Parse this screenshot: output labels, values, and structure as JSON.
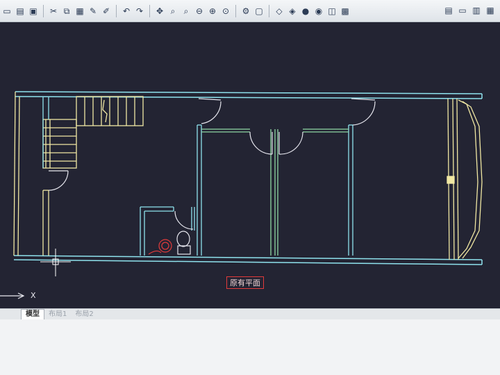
{
  "toolbar": {
    "buttons": [
      {
        "name": "new-icon",
        "glyph": "▭"
      },
      {
        "name": "open-icon",
        "glyph": "▤"
      },
      {
        "name": "save-icon",
        "glyph": "▣"
      },
      {
        "name": "cut-icon",
        "glyph": "✂"
      },
      {
        "name": "copy-icon",
        "glyph": "⧉"
      },
      {
        "name": "paste-icon",
        "glyph": "▦"
      },
      {
        "name": "match-properties-icon",
        "glyph": "✎"
      },
      {
        "name": "block-editor-icon",
        "glyph": "✐"
      },
      {
        "name": "undo-icon",
        "glyph": "↶"
      },
      {
        "name": "redo-icon",
        "glyph": "↷"
      },
      {
        "name": "pan-icon",
        "glyph": "✥"
      },
      {
        "name": "zoom-realtime-icon",
        "glyph": "⌕"
      },
      {
        "name": "zoom-window-icon",
        "glyph": "⌕"
      },
      {
        "name": "zoom-previous-icon",
        "glyph": "⊖"
      },
      {
        "name": "zoom-in-icon",
        "glyph": "⊕"
      },
      {
        "name": "zoom-out-icon",
        "glyph": "⊙"
      },
      {
        "name": "properties-icon",
        "glyph": "⚙"
      },
      {
        "name": "design-center-icon",
        "glyph": "▢"
      },
      {
        "name": "tool-palette-icon",
        "glyph": "◇"
      },
      {
        "name": "sheet-set-icon",
        "glyph": "◈"
      },
      {
        "name": "render-icon",
        "glyph": "●"
      },
      {
        "name": "materials-icon",
        "glyph": "◉"
      },
      {
        "name": "markup-icon",
        "glyph": "◫"
      },
      {
        "name": "quickcalc-icon",
        "glyph": "▩"
      }
    ],
    "right_buttons": [
      {
        "name": "layer-icon",
        "glyph": "▤"
      },
      {
        "name": "window-icon",
        "glyph": "▭"
      },
      {
        "name": "layout-icon",
        "glyph": "▥"
      },
      {
        "name": "table-icon",
        "glyph": "▦"
      }
    ]
  },
  "drawing": {
    "plan_title": "原有平面",
    "ucs_axis_label": "X"
  },
  "tabs": {
    "active": "模型",
    "inactive": [
      "布局1",
      "布局2"
    ]
  },
  "colors": {
    "canvas_background": "#232433",
    "wall_cyan": "#8fe3ee",
    "wall_yellow": "#f1e8a3",
    "door_white": "#e6e6ee",
    "green": "#8fd6a3",
    "red": "#e23b3b",
    "toolbar_background": "#e4e7ea"
  }
}
